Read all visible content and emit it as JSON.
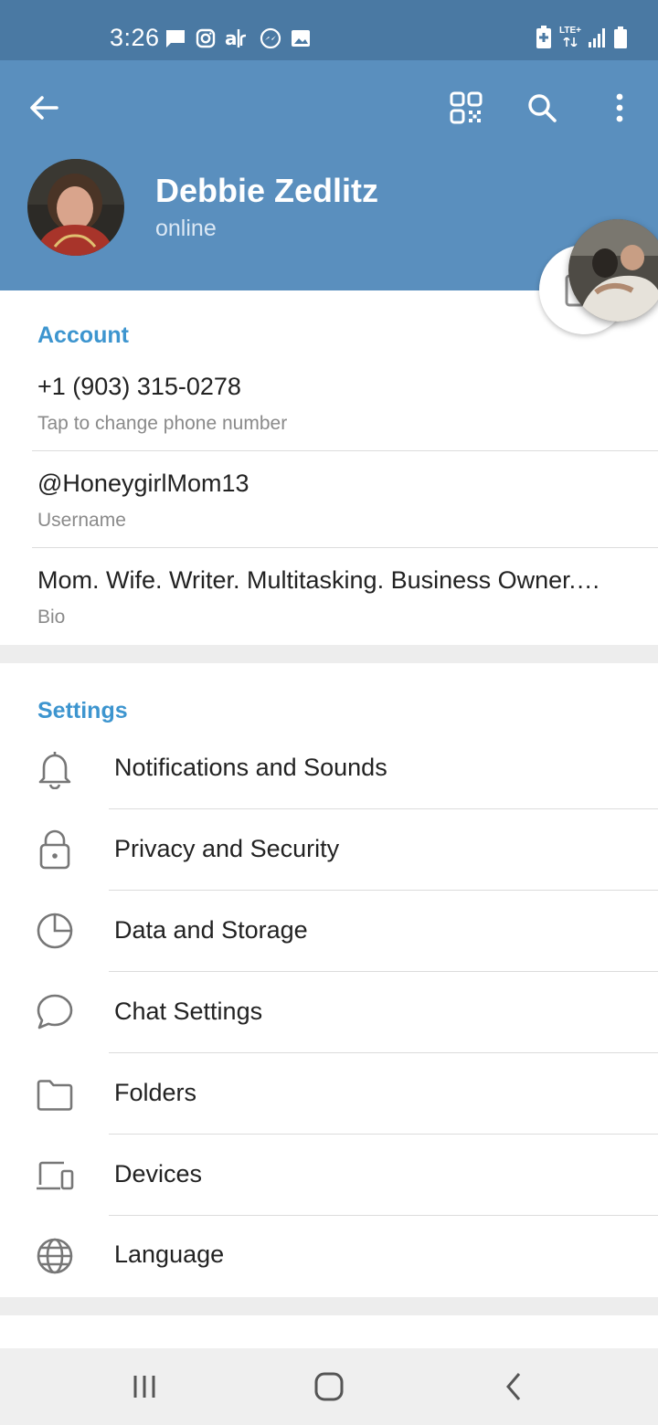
{
  "status_bar": {
    "time": "3:26",
    "network": "LTE+",
    "left_icons": [
      "message-icon",
      "instagram-icon",
      "air-icon",
      "messenger-icon",
      "image-icon"
    ],
    "right_icons": [
      "battery-saver-icon",
      "lte-icon",
      "signal-icon",
      "battery-icon"
    ]
  },
  "header": {
    "name": "Debbie Zedlitz",
    "status": "online",
    "background": "#5a8fbe",
    "status_bar_color": "#4a79a3"
  },
  "account": {
    "title": "Account",
    "phone": "+1 (903) 315-0278",
    "phone_hint": "Tap to change phone number",
    "username": "@HoneygirlMom13",
    "username_label": "Username",
    "bio": "Mom. Wife. Writer. Multitasking. Business Owner.…",
    "bio_label": "Bio"
  },
  "settings": {
    "title": "Settings",
    "items": [
      {
        "label": "Notifications and Sounds",
        "icon": "bell-icon"
      },
      {
        "label": "Privacy and Security",
        "icon": "lock-icon"
      },
      {
        "label": "Data and Storage",
        "icon": "pie-chart-icon"
      },
      {
        "label": "Chat Settings",
        "icon": "chat-bubble-icon"
      },
      {
        "label": "Folders",
        "icon": "folder-icon"
      },
      {
        "label": "Devices",
        "icon": "devices-icon"
      },
      {
        "label": "Language",
        "icon": "globe-icon"
      }
    ]
  },
  "colors": {
    "accent": "#3d95cf",
    "header": "#5a8fbe"
  }
}
